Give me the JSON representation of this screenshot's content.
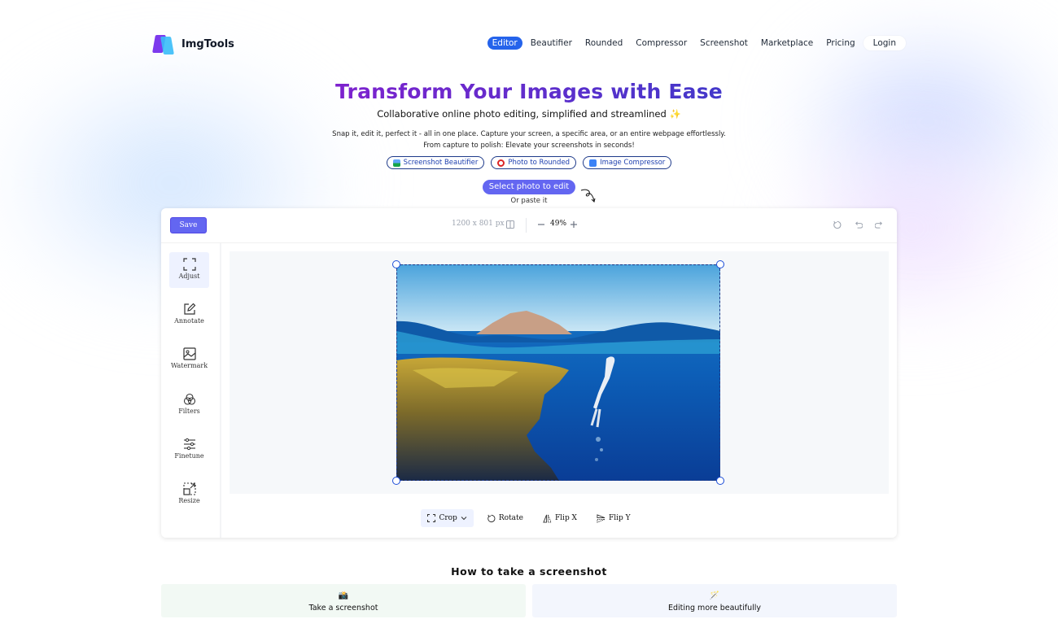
{
  "brand": {
    "name": "ImgTools"
  },
  "nav": {
    "items": [
      {
        "label": "Editor",
        "active": true
      },
      {
        "label": "Beautifier"
      },
      {
        "label": "Rounded"
      },
      {
        "label": "Compressor"
      },
      {
        "label": "Screenshot"
      },
      {
        "label": "Marketplace"
      },
      {
        "label": "Pricing"
      }
    ],
    "login": "Login"
  },
  "hero": {
    "title": "Transform Your Images with Ease",
    "subtitle": "Collaborative online photo editing, simplified and streamlined ✨",
    "description_line1": "Snap it, edit it, perfect it - all in one place. Capture your screen, a specific area, or an entire webpage effortlessly.",
    "description_line2": "From capture to polish: Elevate your screenshots in seconds!",
    "chips": [
      {
        "label": "Screenshot Beautifier",
        "icon": "image-icon"
      },
      {
        "label": "Photo to Rounded",
        "icon": "lifebuoy-icon"
      },
      {
        "label": "Image Compressor",
        "icon": "download-icon"
      }
    ],
    "select_button": "Select photo to edit",
    "paste_hint": "Or paste it"
  },
  "editor": {
    "save_label": "Save",
    "dimensions": "1200 x 801 px",
    "zoom": "49%",
    "side_tools": [
      {
        "label": "Adjust",
        "icon": "crop-frame-icon",
        "active": true
      },
      {
        "label": "Annotate",
        "icon": "pencil-square-icon"
      },
      {
        "label": "Watermark",
        "icon": "image-icon"
      },
      {
        "label": "Filters",
        "icon": "circles-icon"
      },
      {
        "label": "Finetune",
        "icon": "sliders-icon"
      },
      {
        "label": "Resize",
        "icon": "resize-icon"
      }
    ],
    "bottom_tools": [
      {
        "label": "Crop",
        "icon": "crop-frame-icon",
        "active": true
      },
      {
        "label": "Rotate",
        "icon": "rotate-icon"
      },
      {
        "label": "Flip X",
        "icon": "flip-x-icon"
      },
      {
        "label": "Flip Y",
        "icon": "flip-y-icon"
      }
    ]
  },
  "how_to": {
    "title": "How to take a screenshot",
    "steps": [
      {
        "emoji": "📸",
        "label": "Take a screenshot"
      },
      {
        "emoji": "🪄",
        "label": "Editing more beautifully"
      }
    ]
  },
  "colors": {
    "accent": "#6366f1",
    "nav_active": "#2563eb",
    "title_gradient_start": "#7e22ce",
    "title_gradient_end": "#4338ca"
  }
}
